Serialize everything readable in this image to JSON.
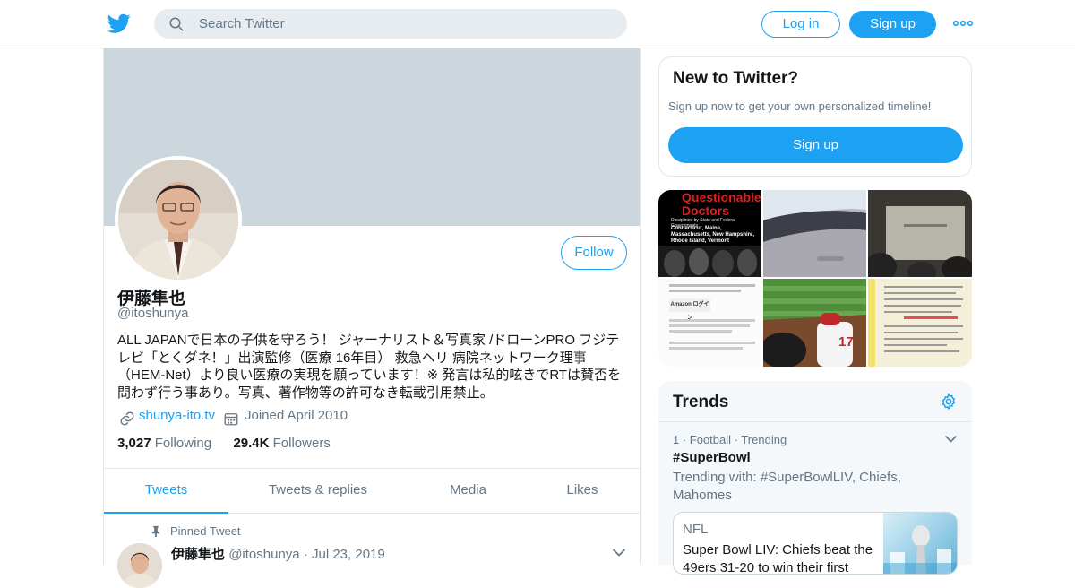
{
  "header": {
    "search_placeholder": "Search Twitter",
    "login_label": "Log in",
    "signup_label": "Sign up"
  },
  "profile": {
    "follow_label": "Follow",
    "name": "伊藤隼也",
    "handle": "@itoshunya",
    "bio": "ALL JAPANで日本の子供を守ろう！ ジャーナリスト＆写真家 /ドローンPRO フジテレビ「とくダネ！」出演監修（医療 16年目） 救急ヘリ 病院ネットワーク理事（HEM-Net）より良い医療の実現を願っています！※ 発言は私的呟きでRTは賛否を問わず行う事あり。写真、著作物等の許可なき転載引用禁止。",
    "website": "shunya-ito.tv",
    "joined": "Joined April 2010",
    "following_count": "3,027",
    "following_label": "Following",
    "followers_count": "29.4K",
    "followers_label": "Followers"
  },
  "tabs": [
    "Tweets",
    "Tweets & replies",
    "Media",
    "Likes"
  ],
  "pinned_tweet": {
    "label": "Pinned Tweet",
    "name": "伊藤隼也",
    "handle": "@itoshunya",
    "date": "Jul 23, 2019"
  },
  "new_to_twitter": {
    "title": "New to Twitter?",
    "subtitle": "Sign up now to get your own personalized timeline!",
    "button": "Sign up"
  },
  "media_grid": {
    "book_title": "Questionable Doctors",
    "book_subtitle": "Disciplined by State and Federal Governments",
    "book_states": "Connecticut, Maine, Massachusetts, New Hampshire, Rhode Island, Vermont",
    "screen_text": "Amazon ログイン",
    "jersey_number": "17"
  },
  "trends": {
    "title": "Trends",
    "items": [
      {
        "meta": "1 · Football · Trending",
        "tag": "#SuperBowl",
        "with": "Trending with: #SuperBowlLIV, Chiefs, Mahomes",
        "news_source": "NFL",
        "news_headline": "Super Bowl LIV: Chiefs beat the 49ers 31-20 to win their first"
      }
    ]
  },
  "colors": {
    "accent": "#1da1f2",
    "banner": "#ccd6dd",
    "muted_text": "#657786"
  }
}
